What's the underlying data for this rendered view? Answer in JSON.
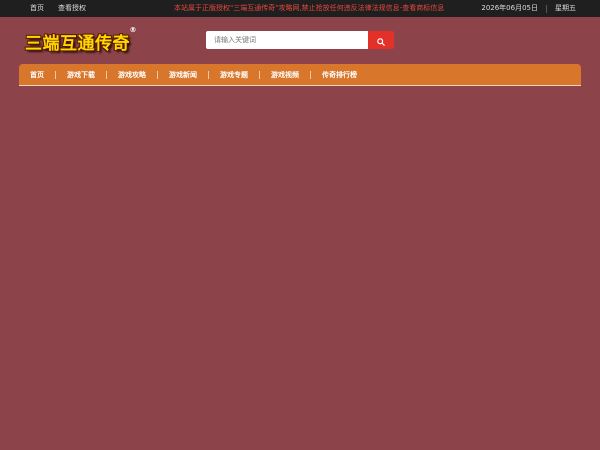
{
  "topbar": {
    "links": [
      "首页",
      "查看授权"
    ],
    "notice": "本站属于正版授权\"三端互通传奇\"攻略网,禁止抢放任何违反法律法规信息-查看商标信息",
    "date": "2026年06月05日",
    "weekday": "星期五"
  },
  "header": {
    "logo_text": "三端互通传奇",
    "logo_reg": "®",
    "search_placeholder": "请输入关键词"
  },
  "nav": {
    "items": [
      "首页",
      "游戏下载",
      "游戏攻略",
      "游戏新闻",
      "游戏专题",
      "游戏视频",
      "传奇排行榜"
    ]
  },
  "colors": {
    "background": "#8c444a",
    "topbar": "#1f1f1f",
    "nav": "#d8762c",
    "search_button": "#e3312a",
    "notice": "#e8473d",
    "logo": "#ffd800"
  }
}
